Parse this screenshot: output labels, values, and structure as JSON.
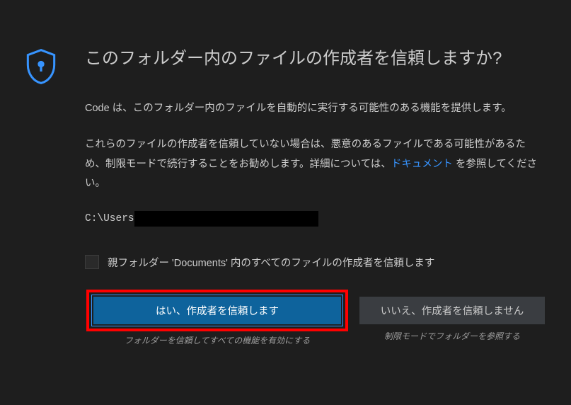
{
  "dialog": {
    "title": "このフォルダー内のファイルの作成者を信頼しますか?",
    "paragraph1": "Code は、このフォルダー内のファイルを自動的に実行する可能性のある機能を提供します。",
    "paragraph2_pre": "これらのファイルの作成者を信頼していない場合は、悪意のあるファイルである可能性があるため、制限モードで続行することをお勧めします。詳細については、",
    "paragraph2_link": "ドキュメント",
    "paragraph2_post": " を参照してください。",
    "path_prefix": "C:\\Users",
    "checkbox_label": "親フォルダー 'Documents' 内のすべてのファイルの作成者を信頼します",
    "trust_button": "はい、作成者を信頼します",
    "trust_subtitle": "フォルダーを信頼してすべての機能を有効にする",
    "dont_trust_button": "いいえ、作成者を信頼しません",
    "dont_trust_subtitle": "制限モードでフォルダーを参照する"
  }
}
